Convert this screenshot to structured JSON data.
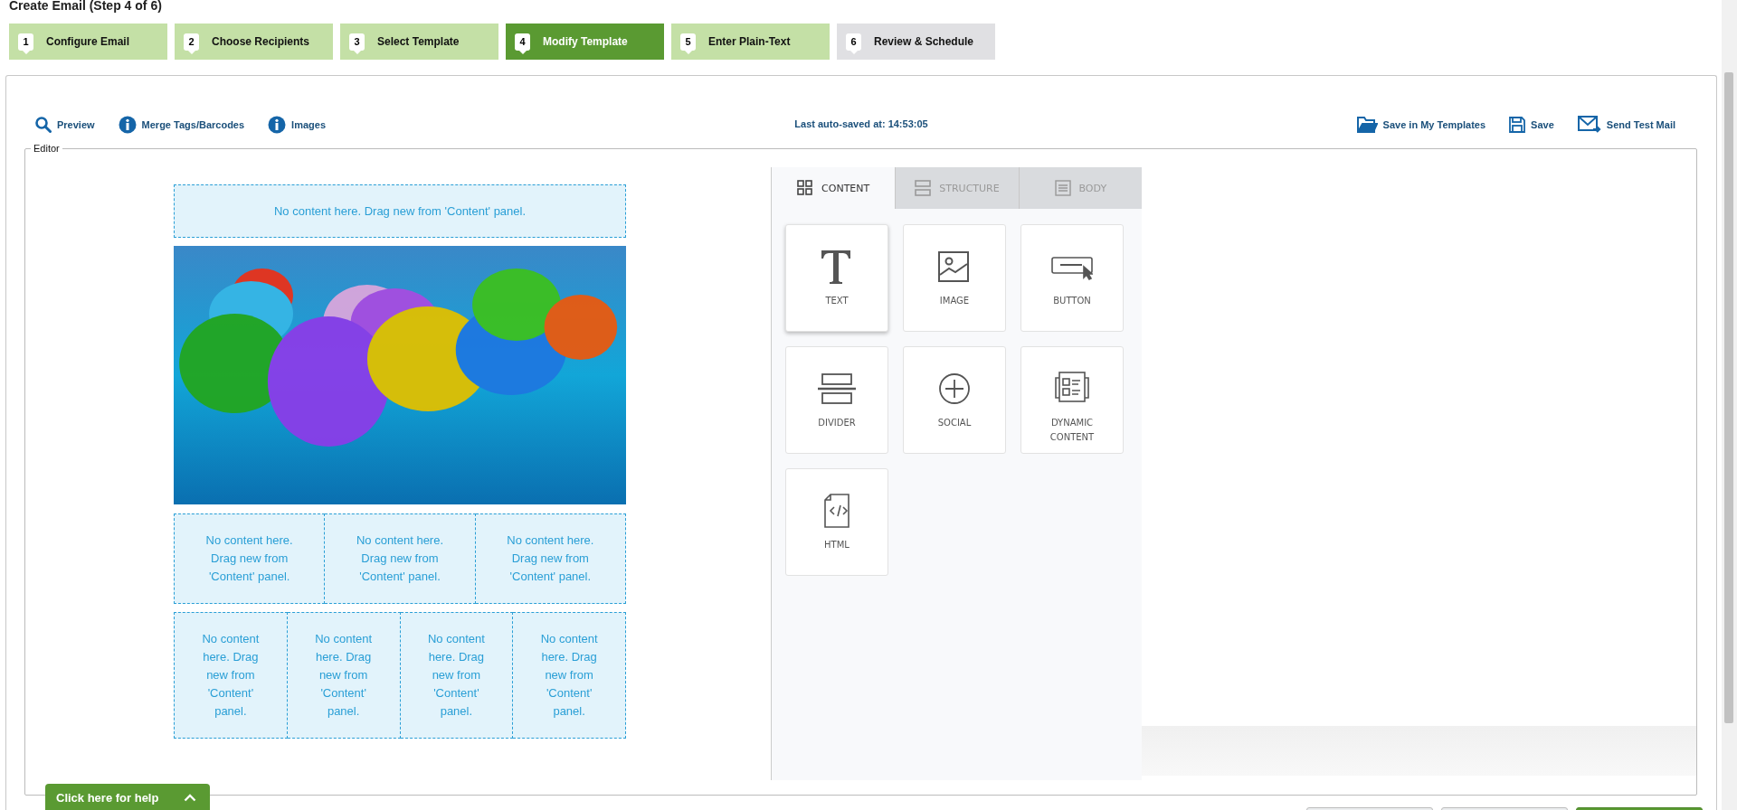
{
  "page_title": "Create Email (Step 4 of 6)",
  "steps": [
    {
      "number": "1",
      "label": "Configure Email",
      "completed": true,
      "selected": false
    },
    {
      "number": "2",
      "label": "Choose Recipients",
      "completed": true,
      "selected": false
    },
    {
      "number": "3",
      "label": "Select Template",
      "completed": true,
      "selected": false
    },
    {
      "number": "4",
      "label": "Modify Template",
      "completed": false,
      "selected": true
    },
    {
      "number": "5",
      "label": "Enter Plain-Text",
      "completed": true,
      "selected": false
    },
    {
      "number": "6",
      "label": "Review & Schedule",
      "completed": false,
      "selected": false
    }
  ],
  "toolbar": {
    "left": [
      {
        "kind": "search",
        "label": "Preview"
      },
      {
        "kind": "info",
        "label": "Merge Tags/Barcodes"
      },
      {
        "kind": "info",
        "label": "Images"
      }
    ],
    "autosave": "Last auto-saved at: 14:53:05",
    "right": [
      {
        "kind": "folder",
        "label": "Save in My Templates"
      },
      {
        "kind": "disk",
        "label": "Save"
      },
      {
        "kind": "mail",
        "label": "Send Test Mail"
      }
    ]
  },
  "editor": {
    "legend": "Editor",
    "rows": [
      {
        "kind": "placeholders",
        "cells": [
          "No content here. Drag new from 'Content' panel."
        ]
      },
      {
        "kind": "photo"
      },
      {
        "kind": "placeholders",
        "cells": [
          "No content here. Drag new from 'Content' panel.",
          "No content here. Drag new from 'Content' panel.",
          "No content here. Drag new from 'Content' panel."
        ]
      },
      {
        "kind": "placeholders",
        "cells": [
          "No content here. Drag new from 'Content' panel.",
          "No content here. Drag new from 'Content' panel.",
          "No content here. Drag new from 'Content' panel.",
          "No content here. Drag new from 'Content' panel."
        ]
      }
    ],
    "panel_tabs": [
      {
        "kind": "grid",
        "label": "CONTENT",
        "selected": true
      },
      {
        "kind": "rows",
        "label": "STRUCTURE",
        "selected": false
      },
      {
        "kind": "page",
        "label": "BODY",
        "selected": false
      }
    ],
    "tiles": [
      {
        "kind": "text",
        "label": "TEXT",
        "hovered": true
      },
      {
        "kind": "image",
        "label": "IMAGE",
        "hovered": false
      },
      {
        "kind": "button",
        "label": "BUTTON",
        "hovered": false
      },
      {
        "kind": "divider",
        "label": "DIVIDER",
        "hovered": false
      },
      {
        "kind": "social",
        "label": "SOCIAL",
        "hovered": false
      },
      {
        "kind": "dynamic",
        "label": "DYNAMIC CONTENT",
        "hovered": false
      },
      {
        "kind": "html",
        "label": "HTML",
        "hovered": false
      }
    ]
  },
  "help": {
    "label": "Click here for help"
  },
  "footer_buttons": [
    {
      "kind": "secondary"
    },
    {
      "kind": "secondary"
    },
    {
      "kind": "primary"
    }
  ]
}
